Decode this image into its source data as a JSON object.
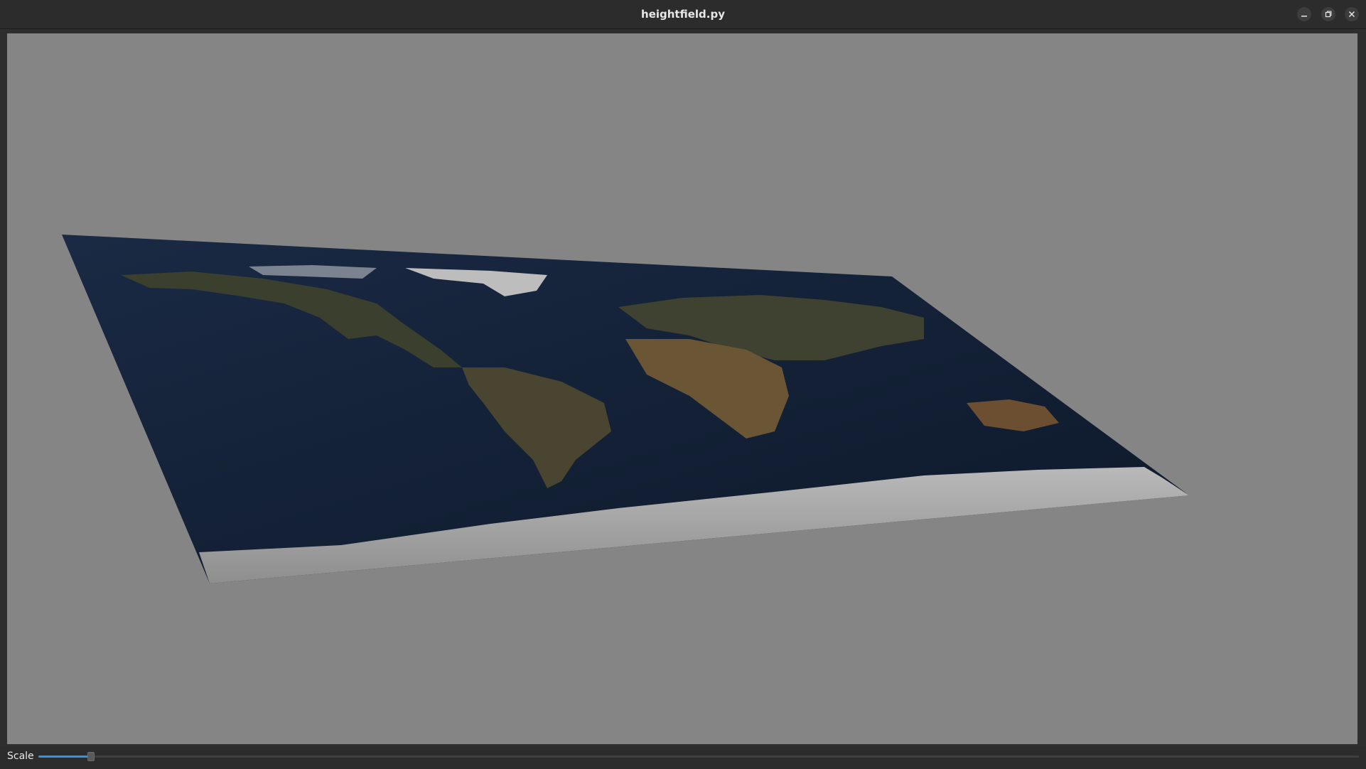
{
  "window": {
    "title": "heightfield.py",
    "controls": {
      "minimize_icon": "minimize-icon",
      "maximize_icon": "restore-icon",
      "close_icon": "close-icon"
    }
  },
  "scene": {
    "background_color": "#858585",
    "description_icon": "earth-heightfield"
  },
  "controls": {
    "scale_label": "Scale",
    "scale_value_fraction": 0.04,
    "accent_color": "#3d8fd6"
  }
}
